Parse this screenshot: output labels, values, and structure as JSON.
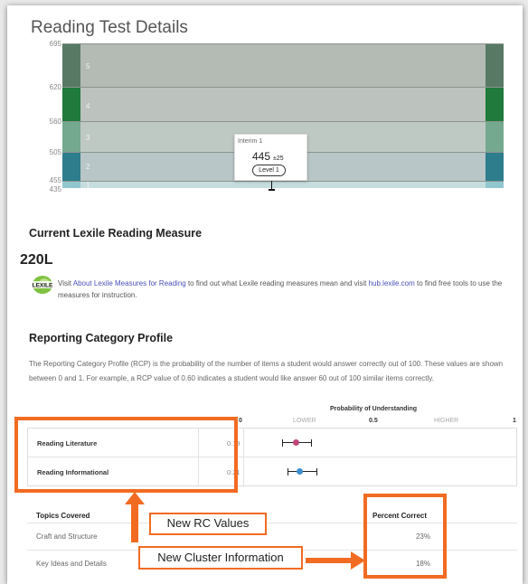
{
  "title": "Reading Test Details",
  "chart": {
    "y_ticks": [
      "695",
      "620",
      "560",
      "505",
      "455",
      "435"
    ],
    "bands": [
      {
        "num": "5",
        "cap": "#587a64",
        "mid": "#b4bbb5"
      },
      {
        "num": "4",
        "cap": "#1f7a3c",
        "mid": "#bcc2bd"
      },
      {
        "num": "3",
        "cap": "#74a98f",
        "mid": "#bfc9c3"
      },
      {
        "num": "2",
        "cap": "#2d7d8c",
        "mid": "#b8c6c7"
      },
      {
        "num": "1",
        "cap": "#91c6cf",
        "mid": "#c6dddf"
      }
    ]
  },
  "popup": {
    "label": "Interim 1",
    "score": "445",
    "error": "±25",
    "level": "Level 1"
  },
  "lexile": {
    "heading": "Current Lexile Reading Measure",
    "value": "220L",
    "logo_text": "LEXILE",
    "text_1": "Visit ",
    "link_1": "About Lexile Measures for Reading",
    "text_2": " to find out what Lexile reading measures mean and visit ",
    "link_2": "hub.lexile.com",
    "text_3": " to find free tools to use the measures for instruction."
  },
  "rcp": {
    "heading": "Reporting Category Profile",
    "description": "The Reporting Category Profile (RCP) is the probability of the number of items a student would answer correctly out of 100. These values are shown between 0 and 1.  For example, a RCP value of 0.60 indicates a student would like answer 60 out of 100 similar items correctly.",
    "prob_heading": "Probability of Understanding",
    "scale": {
      "zero": "0",
      "lower": "LOWER",
      "half": "0.5",
      "higher": "HIGHER",
      "one": "1"
    },
    "rows": [
      {
        "name": "Reading Literature",
        "value": "0.19",
        "dot_color": "#c0467a"
      },
      {
        "name": "Reading Informational",
        "value": "0.21",
        "dot_color": "#3d8fcf"
      }
    ]
  },
  "topics": {
    "heading": "Topics Covered",
    "pct_heading": "Percent Correct",
    "rows": [
      {
        "name": "Craft and Structure",
        "pct": "23%"
      },
      {
        "name": "Key Ideas and Details",
        "pct": "18%"
      }
    ]
  },
  "annotations": {
    "rc_callout": "New RC Values",
    "cluster_callout": "New Cluster Information",
    "accent": "#f26b22"
  }
}
